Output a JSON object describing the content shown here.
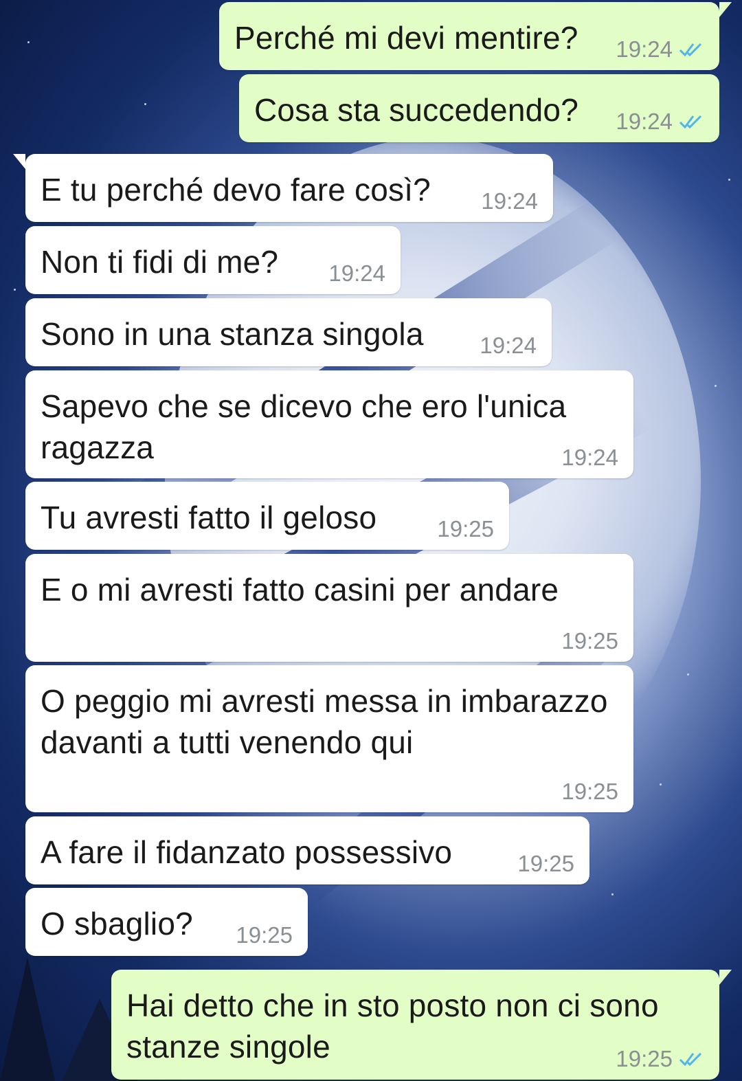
{
  "theme": {
    "incoming_bubble": "#ffffff",
    "outgoing_bubble": "#e2fdc6",
    "read_ticks": "#4fb6ec",
    "time_text": "#8a8f93"
  },
  "messages": [
    {
      "direction": "out",
      "text": "Perché mi devi mentire?",
      "time": "19:24",
      "status": "read",
      "tail": true
    },
    {
      "direction": "out",
      "text": "Cosa sta succedendo?",
      "time": "19:24",
      "status": "read",
      "tail": false
    },
    {
      "direction": "in",
      "text": "E tu perché devo fare così?",
      "time": "19:24",
      "tail": true
    },
    {
      "direction": "in",
      "text": "Non ti fidi di me?",
      "time": "19:24",
      "tail": false
    },
    {
      "direction": "in",
      "text": "Sono in una stanza singola",
      "time": "19:24",
      "tail": false
    },
    {
      "direction": "in",
      "text": "Sapevo che se dicevo che ero l'unica ragazza",
      "time": "19:24",
      "tail": false
    },
    {
      "direction": "in",
      "text": "Tu avresti fatto il geloso",
      "time": "19:25",
      "tail": false
    },
    {
      "direction": "in",
      "text": "E o mi avresti fatto casini per andare",
      "time": "19:25",
      "tail": false
    },
    {
      "direction": "in",
      "text": "O peggio mi avresti messa in imbarazzo davanti a tutti venendo qui",
      "time": "19:25",
      "tail": false
    },
    {
      "direction": "in",
      "text": "A fare il fidanzato possessivo",
      "time": "19:25",
      "tail": false
    },
    {
      "direction": "in",
      "text": "O sbaglio?",
      "time": "19:25",
      "tail": false
    },
    {
      "direction": "out",
      "text": "Hai detto che in sto posto non ci sono stanze singole",
      "time": "19:25",
      "status": "read",
      "tail": true
    }
  ]
}
